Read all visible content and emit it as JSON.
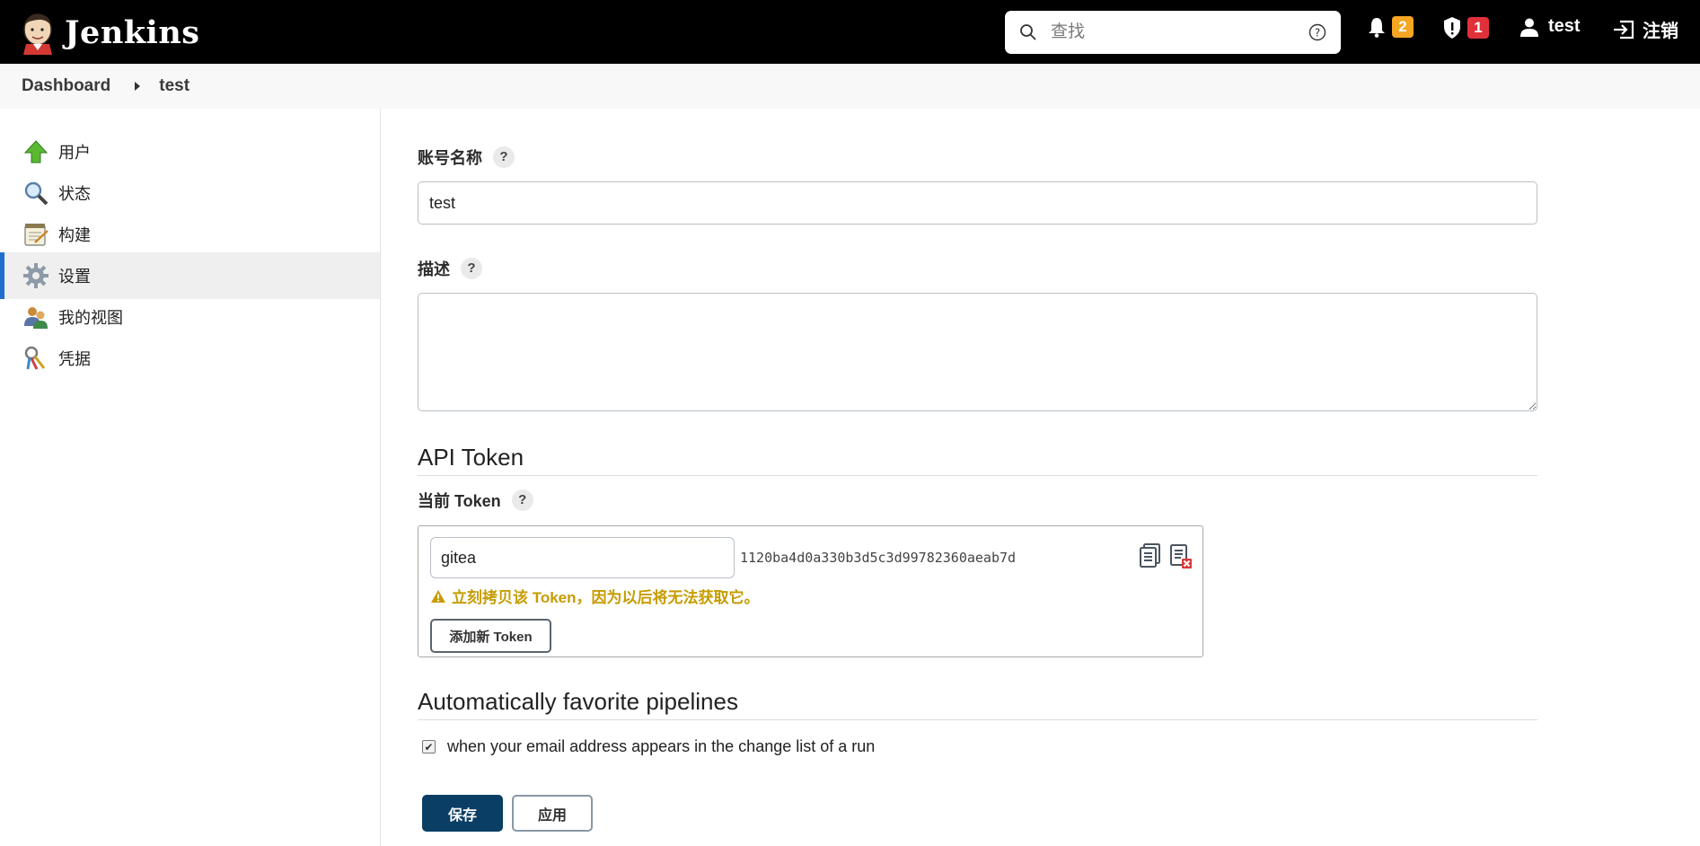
{
  "header": {
    "brand": "Jenkins",
    "search_placeholder": "查找",
    "notifications_count": "2",
    "security_count": "1",
    "user": "test",
    "logout": "注销",
    "colors": {
      "background": "#000000",
      "notif_badge": "#f5a623",
      "security_badge": "#e0313b"
    }
  },
  "breadcrumb": [
    "Dashboard",
    "test"
  ],
  "sidebar": {
    "items": [
      {
        "label": "用户",
        "icon": "up-arrow-icon"
      },
      {
        "label": "状态",
        "icon": "magnifier-icon"
      },
      {
        "label": "构建",
        "icon": "notepad-icon"
      },
      {
        "label": "设置",
        "icon": "gear-icon",
        "active": true
      },
      {
        "label": "我的视图",
        "icon": "users-icon"
      },
      {
        "label": "凭据",
        "icon": "keys-icon"
      }
    ]
  },
  "form": {
    "account_name_label": "账号名称",
    "account_name_value": "test",
    "description_label": "描述",
    "description_value": "",
    "help_mark": "?"
  },
  "api_token": {
    "section_title": "API Token",
    "current_label": "当前 Token",
    "token_name": "gitea",
    "token_value": "1120ba4d0a330b3d5c3d99782360aeab7d",
    "warning": "立刻拷贝该 Token，因为以后将无法获取它。",
    "add_button": "添加新 Token"
  },
  "favorites": {
    "section_title": "Automatically favorite pipelines",
    "checkbox_label": "when your email address appears in the change list of a run",
    "checked": true
  },
  "buttons": {
    "save": "保存",
    "apply": "应用"
  }
}
